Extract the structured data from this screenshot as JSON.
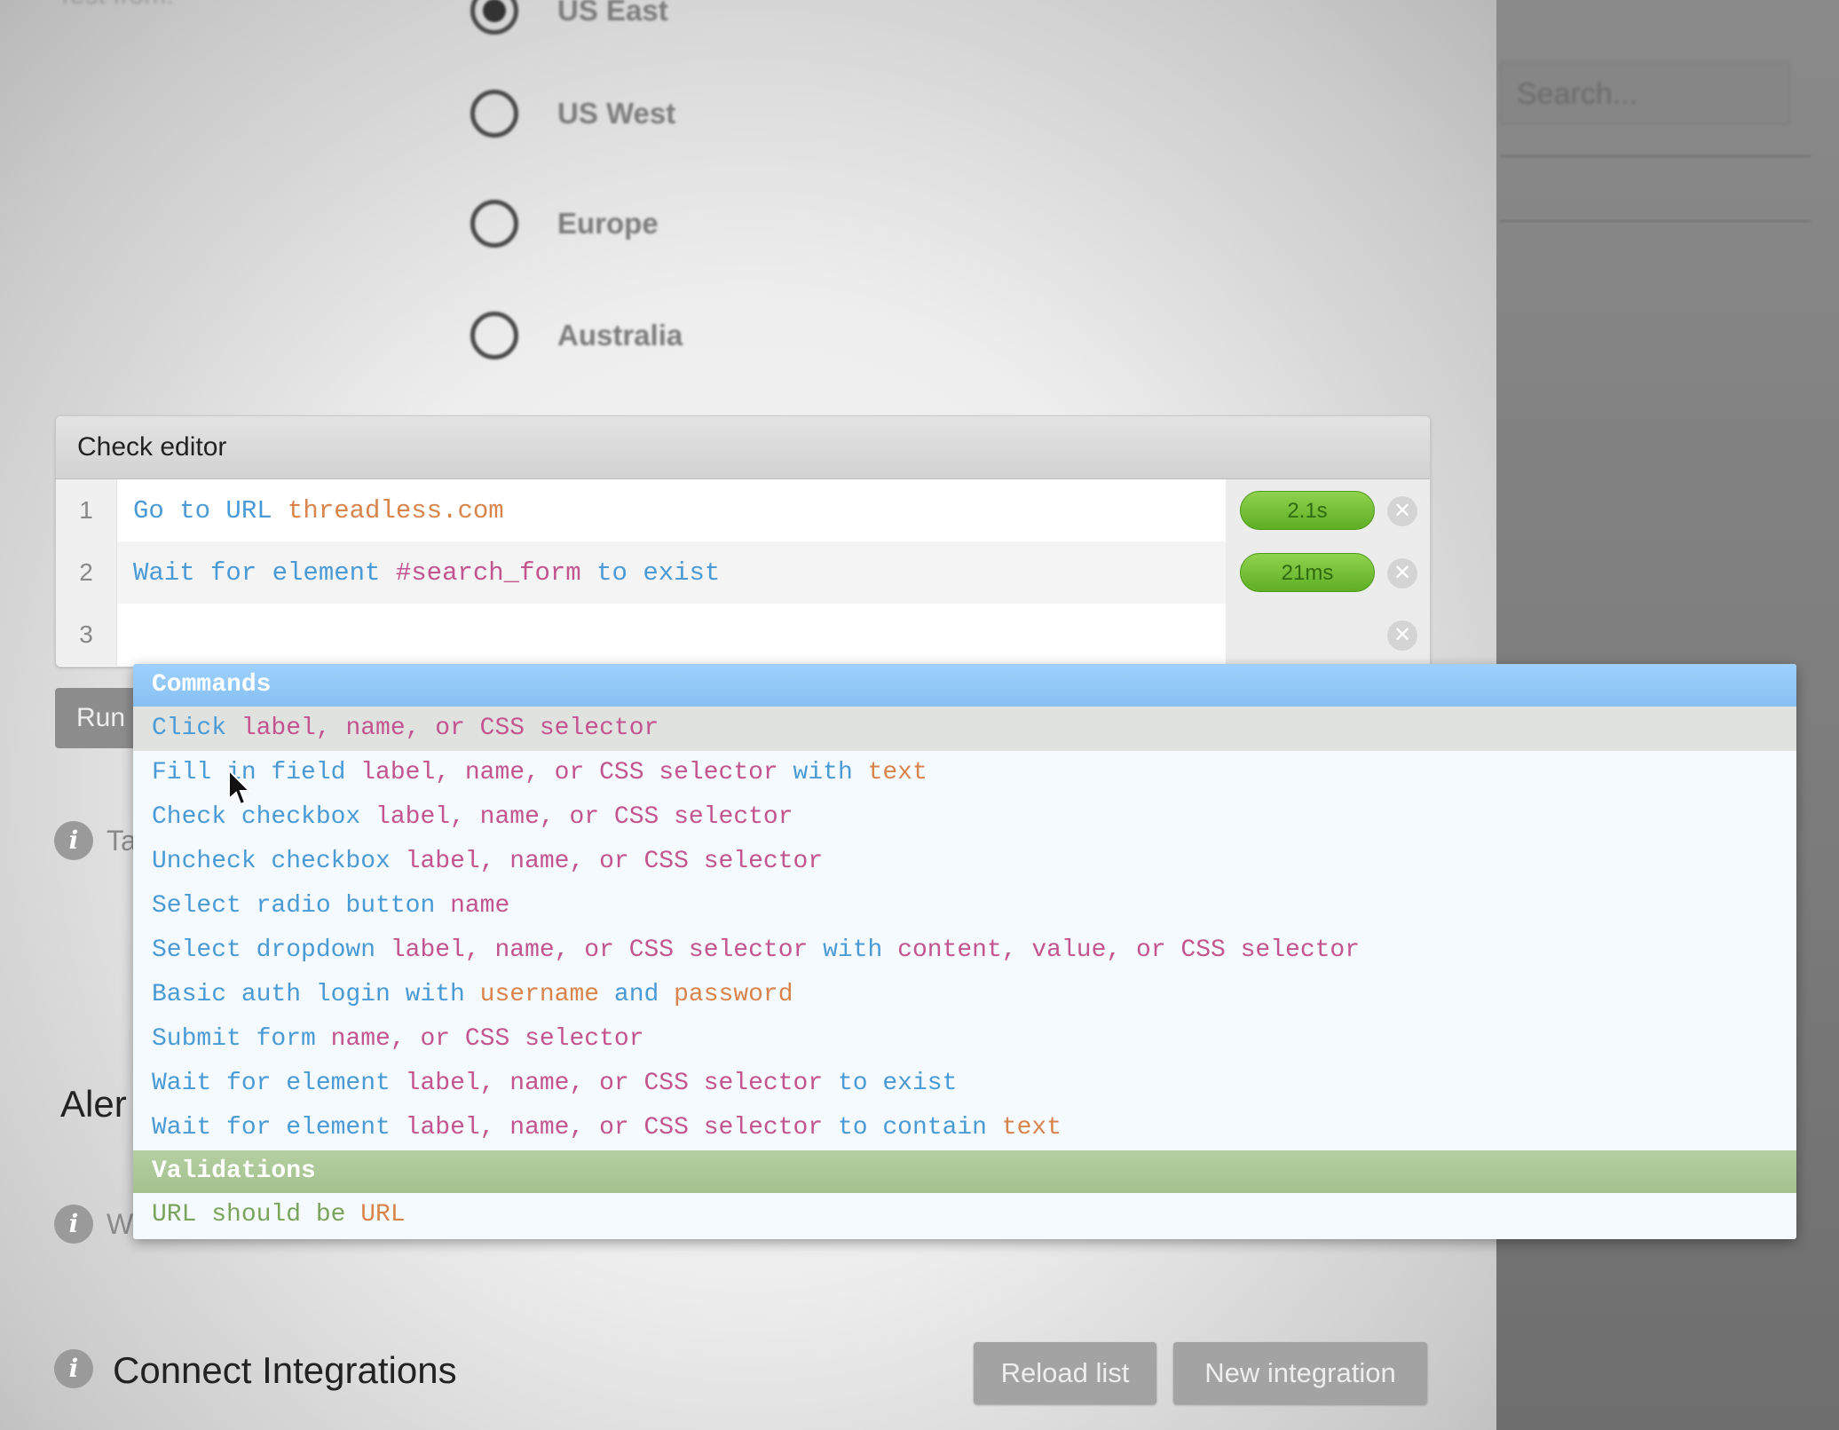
{
  "test_from": {
    "label": "Test from:",
    "options": [
      {
        "label": "US East",
        "selected": true
      },
      {
        "label": "US West",
        "selected": false
      },
      {
        "label": "Europe",
        "selected": false
      },
      {
        "label": "Australia",
        "selected": false
      }
    ]
  },
  "sidebar": {
    "search_placeholder": "Search..."
  },
  "check_editor": {
    "title": "Check editor",
    "rows": [
      {
        "num": "1",
        "parts": {
          "cmd": "Go to URL ",
          "arg": "threadless.com"
        },
        "timing": "2.1s"
      },
      {
        "num": "2",
        "parts": {
          "cmd": "Wait for element ",
          "sel": "#search_form",
          "cmd2": " to exist"
        },
        "timing": "21ms"
      },
      {
        "num": "3",
        "parts": {},
        "timing": ""
      }
    ],
    "remove_glyph": "✕"
  },
  "run_button": {
    "label": "Run"
  },
  "info_fragments": {
    "first": "Ta",
    "second": "W",
    "icon": "i"
  },
  "alerts_fragment": "Aler",
  "autocomplete": {
    "commands_header": "Commands",
    "items": [
      {
        "a": "Click ",
        "b": "label, name, or CSS selector",
        "c": "",
        "d": "",
        "e": "",
        "f": ""
      },
      {
        "a": "Fill in field ",
        "b": "label, name, or CSS selector",
        "c": " with ",
        "d": "text",
        "e": "",
        "f": ""
      },
      {
        "a": "Check checkbox ",
        "b": "label, name, or CSS selector",
        "c": "",
        "d": "",
        "e": "",
        "f": ""
      },
      {
        "a": "Uncheck checkbox ",
        "b": "label, name, or CSS selector",
        "c": "",
        "d": "",
        "e": "",
        "f": ""
      },
      {
        "a": "Select radio button ",
        "b": "name",
        "c": "",
        "d": "",
        "e": "",
        "f": ""
      },
      {
        "a": "Select dropdown ",
        "b": "label, name, or CSS selector",
        "c": " with ",
        "e": "content, value, or CSS selector",
        "d": "",
        "f": ""
      },
      {
        "a": "Basic auth login with ",
        "b": "",
        "c": "",
        "d": "username",
        "e": "",
        "f": " and ",
        "g": "password"
      },
      {
        "a": "Submit form ",
        "b": "name, or CSS selector",
        "c": "",
        "d": "",
        "e": "",
        "f": ""
      },
      {
        "a": "Wait for element ",
        "b": "label, name, or CSS selector",
        "c": " to exist",
        "d": "",
        "e": "",
        "f": ""
      },
      {
        "a": "Wait for element ",
        "b": "label, name, or CSS selector",
        "c": " to contain ",
        "d": "text",
        "e": "",
        "f": ""
      }
    ],
    "validations_header": "Validations",
    "validation_items": [
      {
        "a": "URL should be ",
        "d": "URL"
      }
    ]
  },
  "integrations": {
    "title": "Connect Integrations",
    "reload_label": "Reload list",
    "new_label": "New integration"
  },
  "colors": {
    "command": "#4a9ad6",
    "argument": "#d8844a",
    "selector": "#c2558f",
    "timing_pill": "#6fbf30",
    "commands_header": "#90c6f6",
    "validations_header": "#a9c794"
  }
}
